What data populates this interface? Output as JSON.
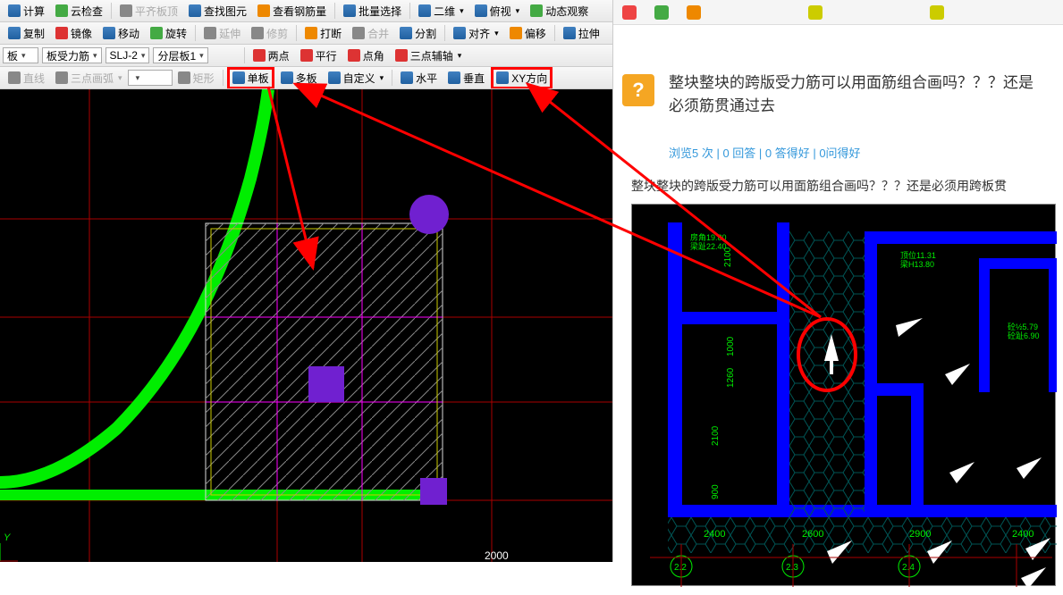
{
  "toolbars": {
    "row1": {
      "jisuan": "计算",
      "yunjian": "云检查",
      "pingqi": "平齐板顶",
      "chazhao": "查找图元",
      "chagang": "查看钢筋量",
      "piliang": "批量选择",
      "erwei": "二维",
      "fushi": "俯视",
      "dongtai": "动态观察"
    },
    "row2": {
      "fuzhi": "复制",
      "jingxiang": "镜像",
      "yidong": "移动",
      "xuanzhuan": "旋转",
      "yanshen": "延伸",
      "xiujian": "修剪",
      "daduan": "打断",
      "hebing": "合并",
      "fenge": "分割",
      "duiqi": "对齐",
      "pianyi": "偏移",
      "lashen": "拉伸"
    },
    "row3": {
      "ban": "板",
      "banshouli": "板受力筋",
      "slj": "SLJ-2",
      "fenceng": "分层板1"
    },
    "row4": {
      "liangdian": "两点",
      "pingxing": "平行",
      "dianjiao": "点角",
      "sandian": "三点辅轴"
    },
    "row5": {
      "zhixian": "直线",
      "sandianhu": "三点画弧",
      "juxing": "矩形",
      "danban": "单板",
      "duoban": "多板",
      "zidingyi": "自定义",
      "shuiping": "水平",
      "chuizhi": "垂直",
      "xyfangxiang": "XY方向"
    }
  },
  "canvas": {
    "coord": "2000"
  },
  "forum": {
    "title": "整块整块的跨版受力筋可以用面筋组合画吗？？？还是必须筋贯通过去",
    "stats": "浏览5 次 | 0 回答 | 0 答得好 | 0问得好",
    "body": "整块整块的跨版受力筋可以用面筋组合画吗？？？还是必须用跨板贯",
    "q_mark": "?"
  },
  "cad_image": {
    "dims": [
      "2400",
      "2600",
      "2900",
      "2400"
    ],
    "nums": [
      "2100",
      "1000",
      "1260",
      "2100",
      "900"
    ],
    "nodes": [
      "2.2",
      "2.3",
      "2.4"
    ],
    "labels": [
      {
        "l1": "房角19.80",
        "l2": "梁趾22.40"
      },
      {
        "l1": "顶位11.31",
        "l2": "梁H13.80"
      },
      {
        "l1": "砼½5.79",
        "l2": "砼趾6.90"
      }
    ]
  }
}
